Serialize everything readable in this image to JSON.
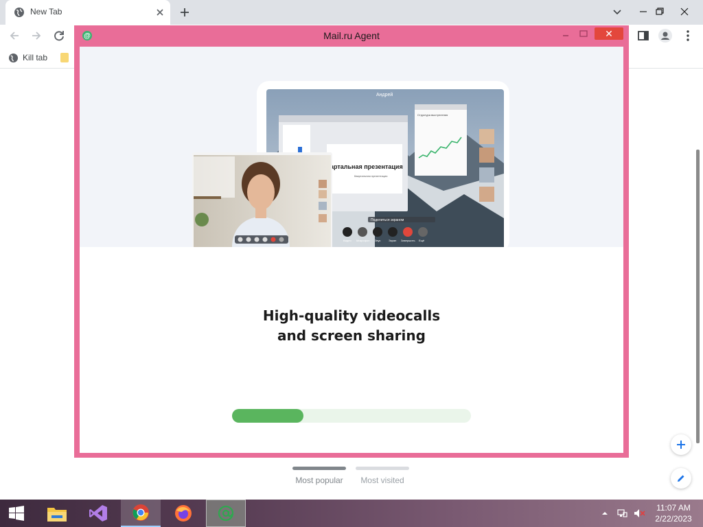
{
  "browser": {
    "tab_title": "New Tab",
    "bookmark_label": "Kill tab",
    "colors": {
      "tabstrip": "#dee1e6",
      "icon": "#5f6368"
    }
  },
  "ntp": {
    "tabs": [
      {
        "label": "Most popular",
        "active": true
      },
      {
        "label": "Most visited",
        "active": false
      }
    ]
  },
  "agent": {
    "title": "Mail.ru Agent",
    "headline_line1": "High-quality videocalls",
    "headline_line2": "and screen sharing",
    "progress_fraction": 0.3,
    "colors": {
      "frame": "#e96d98",
      "close": "#e3473c",
      "progress_fill": "#5ab55e",
      "progress_track": "#eaf5ea"
    },
    "illustration": {
      "caller_name": "Андрей",
      "slide_title": "артальная презентация",
      "slide_subtitle": "Квартальная презентация",
      "toast": "Поделиться экраном",
      "doc_title": "Структура выступления",
      "controls": [
        "Видео",
        "Микрофон",
        "Звук",
        "Экран",
        "Завершить",
        "Ещё"
      ]
    }
  },
  "taskbar": {
    "apps": [
      "start-icon",
      "file-explorer-icon",
      "visual-studio-icon",
      "chrome-icon",
      "firefox-icon",
      "mail-agent-icon"
    ],
    "time": "11:07 AM",
    "date": "2/22/2023"
  }
}
